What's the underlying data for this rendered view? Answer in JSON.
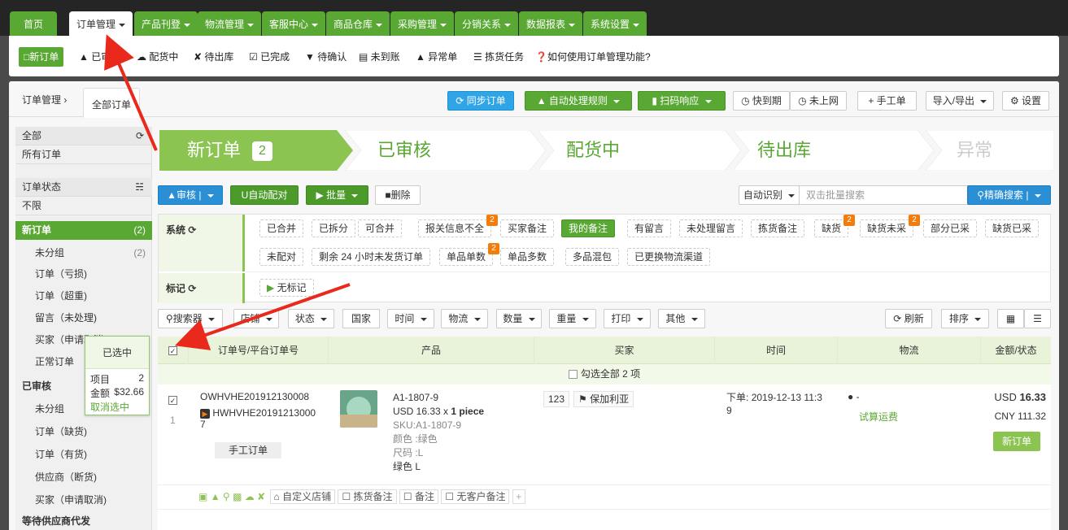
{
  "topnav": {
    "tabs": [
      "首页",
      "订单管理",
      "产品刊登",
      "物流管理",
      "客服中心",
      "商品仓库",
      "采购管理",
      "分销关系",
      "数据报表",
      "系统设置"
    ]
  },
  "subnav": {
    "items": [
      "新订单",
      "已审核",
      "配货中",
      "待出库",
      "已完成",
      "待确认",
      "未到账",
      "异常单",
      "拣货任务"
    ],
    "help": "如何使用订单管理功能?"
  },
  "breadcrumb": {
    "root": "订单管理",
    "current": "全部订单"
  },
  "toolbar": {
    "sync": "同步订单",
    "auto_rule": "自动处理规则",
    "scan": "扫码响应",
    "expire": "快到期",
    "notonline": "未上网",
    "manual": "手工单",
    "importexport": "导入/导出",
    "settings": "设置"
  },
  "sidebar": {
    "rows": [
      {
        "label": "全部",
        "count": ""
      },
      {
        "label": "所有订单",
        "count": ""
      },
      {
        "label": "订单状态",
        "count": ""
      },
      {
        "label": "不限",
        "count": ""
      },
      {
        "label": "新订单",
        "count": "(2)"
      },
      {
        "label": "未分组",
        "count": "(2)"
      },
      {
        "label": "订单（亏损)",
        "count": ""
      },
      {
        "label": "订单（超重)",
        "count": ""
      },
      {
        "label": "留言（未处理)",
        "count": ""
      },
      {
        "label": "买家（申请取消)",
        "count": ""
      },
      {
        "label": "正常订单",
        "count": ""
      },
      {
        "label": "已审核",
        "count": ""
      },
      {
        "label": "未分组",
        "count": ""
      },
      {
        "label": "订单（缺货)",
        "count": ""
      },
      {
        "label": "订单（有货)",
        "count": ""
      },
      {
        "label": "供应商（断货)",
        "count": ""
      },
      {
        "label": "买家（申请取消)",
        "count": ""
      },
      {
        "label": "等待供应商代发",
        "count": ""
      }
    ]
  },
  "steps": {
    "new": "新订单",
    "new_count": "2",
    "approved": "已审核",
    "allocating": "配货中",
    "pending_out": "待出库",
    "abnormal": "异常"
  },
  "actions": {
    "approve": "审核",
    "auto_match": "自动配对",
    "batch": "批量",
    "delete": "删除",
    "auto_detect": "自动识别",
    "search_placeholder": "双击批量搜索",
    "precise_search": "精确搜索"
  },
  "filters": {
    "system_label": "系统",
    "mark_label": "标记",
    "row1": [
      "已合并",
      "已拆分",
      "可合并",
      "报关信息不全",
      "买家备注",
      "我的备注",
      "有留言",
      "未处理留言",
      "拣货备注",
      "缺货",
      "缺货未采",
      "部分已采",
      "缺货已采"
    ],
    "row2": [
      "未配对",
      "剩余 24 小时未发货订单",
      "单品单数",
      "单品多数",
      "多品混包",
      "已更换物流渠道"
    ],
    "no_mark": "无标记",
    "badge": "2"
  },
  "search_bar": {
    "items": [
      "搜索器",
      "店铺",
      "状态",
      "国家",
      "时间",
      "物流",
      "数量",
      "重量",
      "打印",
      "其他"
    ],
    "refresh": "刷新",
    "sort": "排序"
  },
  "table": {
    "headers": [
      "订单号/平台订单号",
      "产品",
      "买家",
      "时间",
      "物流",
      "金额/状态"
    ],
    "select_all": "勾选全部 2 项"
  },
  "order": {
    "order_no": "OWHVHE201912130008",
    "platform_no_a": "HWHVHE20191213000",
    "platform_no_b": "7",
    "index": "1",
    "manual_tag": "手工订单",
    "sku_title": "A1-1807-9",
    "price": "USD 16.33 x ",
    "qty": "1 piece",
    "sku": "SKU:A1-1807-9",
    "color": "颜色 :绿色",
    "size": "尺码 :L",
    "variant": "绿色 L",
    "buyer_id": "123",
    "buyer_country": "保加利亚",
    "time_label": "下单:",
    "time_a": "2019-12-13 11:3",
    "time_b": "9",
    "logistics": "-",
    "trial": "试算运费",
    "amt_usd_prefix": "USD ",
    "amt_usd": "16.33",
    "amt_cny": "CNY 111.32",
    "status": "新订单",
    "tags": [
      "自定义店铺",
      "拣货备注",
      "备注",
      "无客户备注"
    ]
  },
  "selection": {
    "title": "已选中",
    "items_label": "项目",
    "items_val": "2",
    "amount_label": "金额",
    "amount_val": "$32.66",
    "cancel": "取消选中"
  },
  "colors": {
    "green": "#5aa834",
    "topnav_bg": "#252525",
    "arrow": "#e8291c",
    "badge": "#f27d0c"
  }
}
